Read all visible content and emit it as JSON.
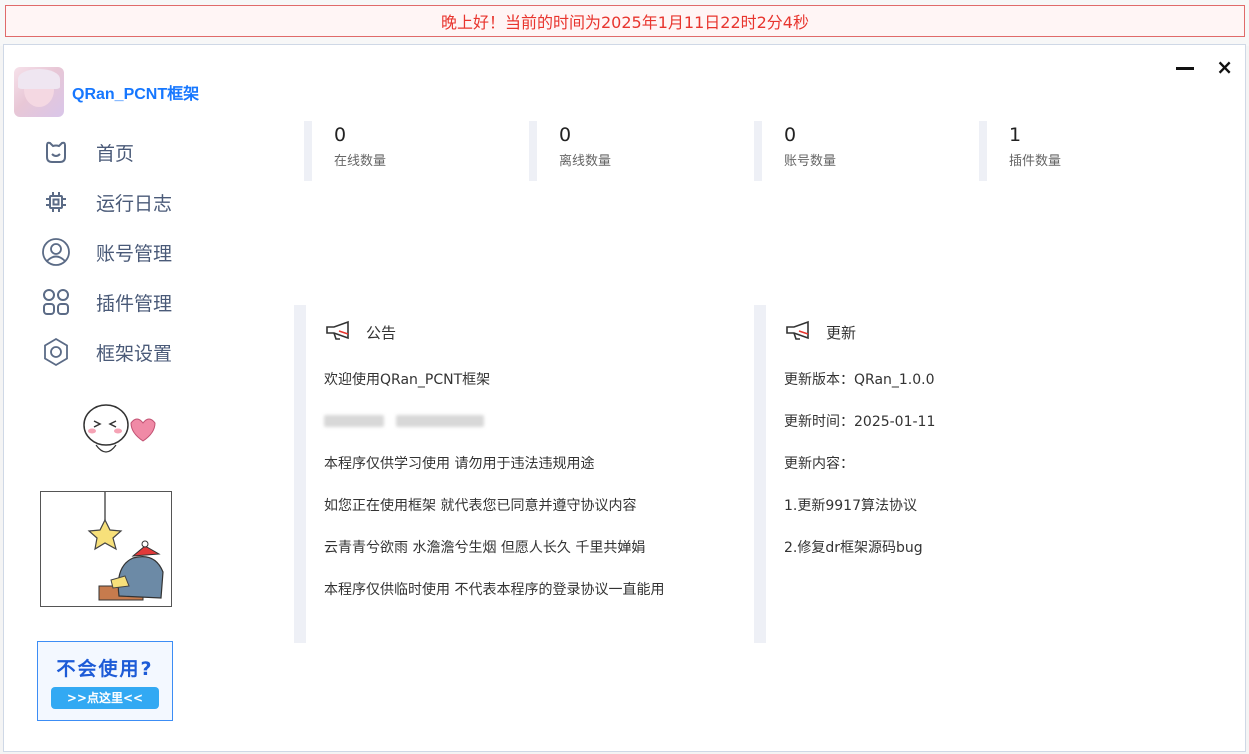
{
  "banner": "晚上好！当前的时间为2025年1月11日22时2分4秒",
  "window": {
    "minimize": "minimize",
    "close": "×"
  },
  "app": {
    "title": "QRan_PCNT框架"
  },
  "sidebar": {
    "items": [
      {
        "label": "首页",
        "icon": "home-icon"
      },
      {
        "label": "运行日志",
        "icon": "chip-icon"
      },
      {
        "label": "账号管理",
        "icon": "user-icon"
      },
      {
        "label": "插件管理",
        "icon": "grid-icon"
      },
      {
        "label": "框架设置",
        "icon": "gear-icon"
      }
    ]
  },
  "help": {
    "title": "不会使用?",
    "button": ">>点这里<<"
  },
  "stats": [
    {
      "value": "0",
      "label": "在线数量"
    },
    {
      "value": "0",
      "label": "离线数量"
    },
    {
      "value": "0",
      "label": "账号数量"
    },
    {
      "value": "1",
      "label": "插件数量"
    }
  ],
  "announcement": {
    "title": "公告",
    "lines": [
      "欢迎使用QRan_PCNT框架",
      "本程序仅供学习使用  请勿用于违法违规用途",
      "如您正在使用框架  就代表您已同意并遵守协议内容",
      "云青青兮欲雨 水澹澹兮生烟 但愿人长久 千里共婵娟",
      "本程序仅供临时使用  不代表本程序的登录协议一直能用"
    ]
  },
  "update": {
    "title": "更新",
    "lines": [
      "更新版本：QRan_1.0.0",
      "更新时间：2025-01-11",
      "更新内容：",
      "1.更新9917算法协议",
      "2.修复dr框架源码bug"
    ]
  },
  "colors": {
    "accent": "#1677ff",
    "banner_text": "#e8352e",
    "banner_border": "#e06a6a",
    "help_button": "#32a9f3"
  }
}
